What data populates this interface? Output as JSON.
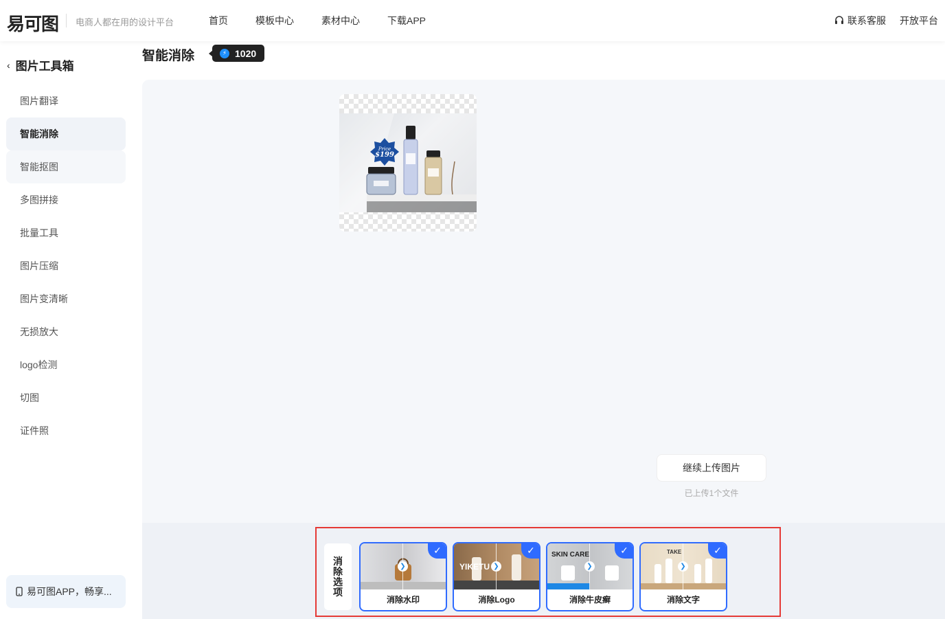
{
  "header": {
    "logo": "易可图",
    "slogan": "电商人都在用的设计平台",
    "nav": [
      "首页",
      "模板中心",
      "素材中心",
      "下载APP"
    ],
    "support_label": "联系客服",
    "open_platform": "开放平台"
  },
  "sidebar": {
    "back_title": "图片工具箱",
    "items": [
      {
        "label": "图片翻译"
      },
      {
        "label": "智能消除"
      },
      {
        "label": "智能抠图"
      },
      {
        "label": "多图拼接"
      },
      {
        "label": "批量工具"
      },
      {
        "label": "图片压缩"
      },
      {
        "label": "图片变清晰"
      },
      {
        "label": "无损放大"
      },
      {
        "label": "logo检测"
      },
      {
        "label": "切图"
      },
      {
        "label": "证件照"
      }
    ],
    "app_banner": "易可图APP，畅享..."
  },
  "main": {
    "title": "智能消除",
    "credits": "1020",
    "thumbnail": {
      "price_tag_top": "Price",
      "price_tag_value": "$199"
    },
    "upload_button": "继续上传图片",
    "upload_note": "已上传1个文件"
  },
  "options": {
    "label": "消除选项",
    "cards": [
      {
        "caption": "消除水印",
        "overtext": ""
      },
      {
        "caption": "消除Logo",
        "overtext": "YIKETU"
      },
      {
        "caption": "消除牛皮癣",
        "overtext": "SKIN CARE"
      },
      {
        "caption": "消除文字",
        "overtext": "TAKE"
      }
    ]
  },
  "colors": {
    "accent": "#2f6bff",
    "highlight_border": "#e53935",
    "credit_bg": "#222222"
  }
}
